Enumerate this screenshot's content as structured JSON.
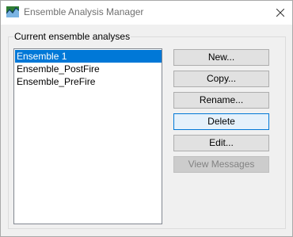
{
  "window": {
    "title": "Ensemble Analysis Manager"
  },
  "group": {
    "legend": "Current ensemble analyses"
  },
  "list": {
    "items": [
      {
        "label": "Ensemble 1",
        "selected": true
      },
      {
        "label": "Ensemble_PostFire",
        "selected": false
      },
      {
        "label": "Ensemble_PreFire",
        "selected": false
      }
    ]
  },
  "buttons": {
    "new": "New...",
    "copy": "Copy...",
    "rename": "Rename...",
    "delete": "Delete",
    "edit": "Edit...",
    "view_messages": "View Messages"
  },
  "icons": {
    "app": "ensemble-app-icon",
    "close": "close-icon"
  },
  "colors": {
    "selection": "#0078d7",
    "focus_border": "#0078d7"
  }
}
